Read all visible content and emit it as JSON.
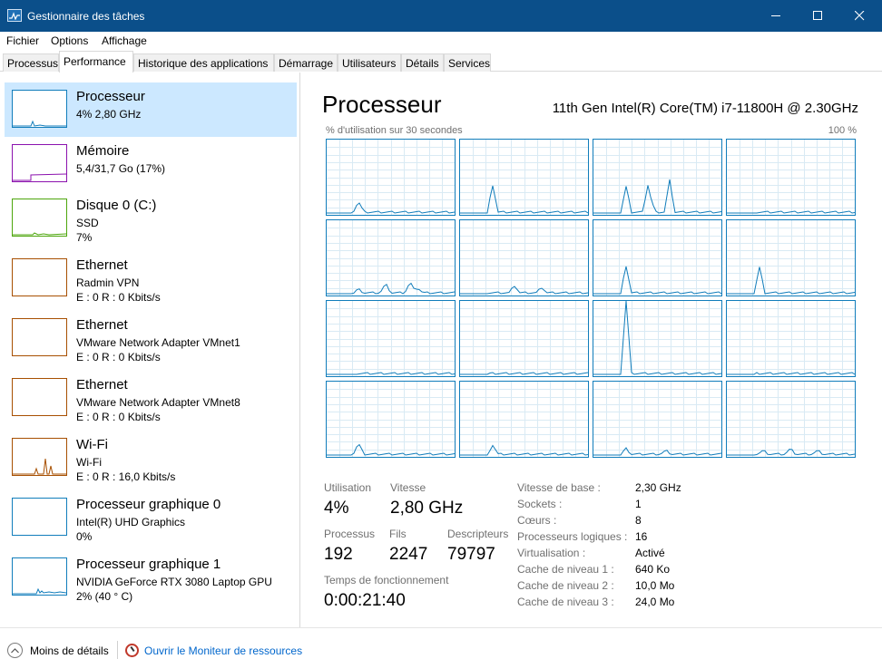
{
  "window": {
    "title": "Gestionnaire des tâches"
  },
  "menu": [
    "Fichier",
    "Options",
    "Affichage"
  ],
  "tabs": [
    "Processus",
    "Performance",
    "Historique des applications",
    "Démarrage",
    "Utilisateurs",
    "Détails",
    "Services"
  ],
  "active_tab": "Performance",
  "resources": [
    {
      "title": "Processeur",
      "line1": "4% 2,80 GHz",
      "line2": "",
      "color": "#117dbb"
    },
    {
      "title": "Mémoire",
      "line1": "5,4/31,7 Go (17%)",
      "line2": "",
      "color": "#8b12ae"
    },
    {
      "title": "Disque 0 (C:)",
      "line1": "SSD",
      "line2": "7%",
      "color": "#4da60c"
    },
    {
      "title": "Ethernet",
      "line1": "Radmin VPN",
      "line2": "E : 0 R : 0 Kbits/s",
      "color": "#a74f01"
    },
    {
      "title": "Ethernet",
      "line1": "VMware Network Adapter VMnet1",
      "line2": "E : 0 R : 0 Kbits/s",
      "color": "#a74f01"
    },
    {
      "title": "Ethernet",
      "line1": "VMware Network Adapter VMnet8",
      "line2": "E : 0 R : 0 Kbits/s",
      "color": "#a74f01"
    },
    {
      "title": "Wi-Fi",
      "line1": "Wi-Fi",
      "line2": "E : 0 R : 16,0 Kbits/s",
      "color": "#a74f01"
    },
    {
      "title": "Processeur graphique 0",
      "line1": "Intel(R) UHD Graphics",
      "line2": "0%",
      "color": "#117dbb"
    },
    {
      "title": "Processeur graphique 1",
      "line1": "NVIDIA GeForce RTX 3080 Laptop GPU",
      "line2": "2% (40 ° C)",
      "color": "#117dbb"
    }
  ],
  "detail": {
    "title": "Processeur",
    "model": "11th Gen Intel(R) Core(TM) i7-11800H @ 2.30GHz",
    "graph_label": "% d'utilisation sur 30 secondes",
    "graph_max": "100 %",
    "stats": {
      "utilisation_label": "Utilisation",
      "utilisation": "4%",
      "vitesse_label": "Vitesse",
      "vitesse": "2,80 GHz",
      "processus_label": "Processus",
      "processus": "192",
      "fils_label": "Fils",
      "fils": "2247",
      "descripteurs_label": "Descripteurs",
      "descripteurs": "79797",
      "uptime_label": "Temps de fonctionnement",
      "uptime": "0:00:21:40"
    },
    "specs": [
      {
        "label": "Vitesse de base :",
        "value": "2,30 GHz"
      },
      {
        "label": "Sockets :",
        "value": "1"
      },
      {
        "label": "Cœurs :",
        "value": "8"
      },
      {
        "label": "Processeurs logiques :",
        "value": "16"
      },
      {
        "label": "Virtualisation :",
        "value": "Activé"
      },
      {
        "label": "Cache de niveau 1 :",
        "value": "640 Ko"
      },
      {
        "label": "Cache de niveau 2 :",
        "value": "10,0 Mo"
      },
      {
        "label": "Cache de niveau 3 :",
        "value": "24,0 Mo"
      }
    ]
  },
  "footer": {
    "less_details": "Moins de détails",
    "resource_monitor": "Ouvrir le Moniteur de ressources"
  },
  "colors": {
    "titlebar": "#0b4f8a",
    "selected": "#cce8ff",
    "cpu_line": "#117dbb",
    "grid": "#d9eaf4"
  }
}
